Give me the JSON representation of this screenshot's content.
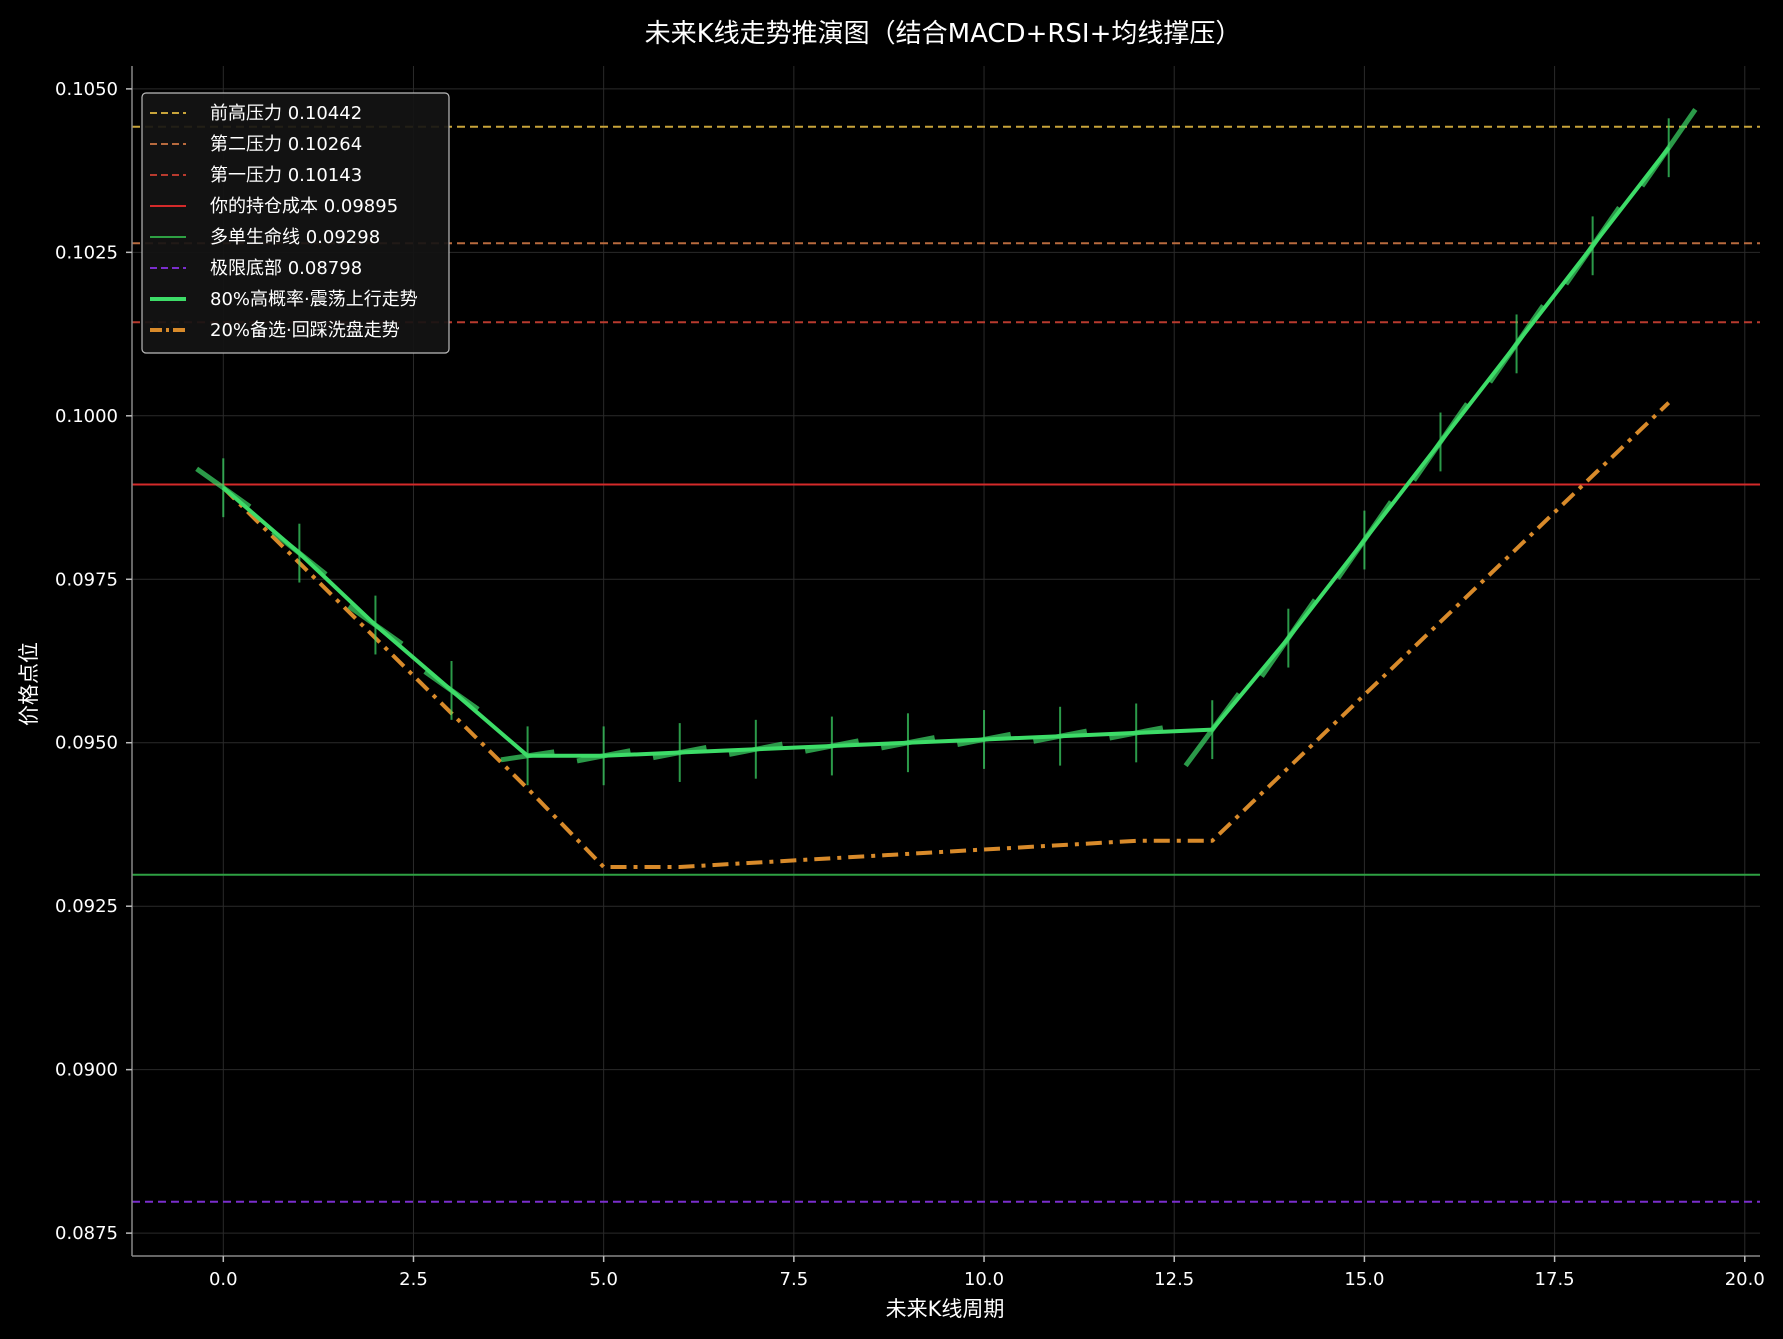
{
  "chart_data": {
    "type": "line",
    "title": "未来K线走势推演图（结合MACD+RSI+均线撑压）",
    "xlabel": "未来K线周期",
    "ylabel": "价格点位",
    "xlim": [
      -1.2,
      20.2
    ],
    "ylim": [
      0.08715,
      0.10535
    ],
    "xticks": [
      0.0,
      2.5,
      5.0,
      7.5,
      10.0,
      12.5,
      15.0,
      17.5,
      20.0
    ],
    "xtick_labels": [
      "0.0",
      "2.5",
      "5.0",
      "7.5",
      "10.0",
      "12.5",
      "15.0",
      "17.5",
      "20.0"
    ],
    "yticks": [
      0.0875,
      0.09,
      0.0925,
      0.095,
      0.0975,
      0.1,
      0.1025,
      0.105
    ],
    "ytick_labels": [
      "0.0875",
      "0.0900",
      "0.0925",
      "0.0950",
      "0.0975",
      "0.1000",
      "0.1025",
      "0.1050"
    ],
    "grid": true,
    "legend_position": "top-left",
    "hlines": [
      {
        "name": "前高压力 0.10442",
        "y": 0.10442,
        "color": "#c8a43a",
        "style": "dashed"
      },
      {
        "name": "第二压力 0.10264",
        "y": 0.10264,
        "color": "#b86a3e",
        "style": "dashed"
      },
      {
        "name": "第一压力 0.10143",
        "y": 0.10143,
        "color": "#b83a2e",
        "style": "dashed"
      },
      {
        "name": "你的持仓成本 0.09895",
        "y": 0.09895,
        "color": "#d42a2a",
        "style": "solid"
      },
      {
        "name": "多单生命线 0.09298",
        "y": 0.09298,
        "color": "#2ea043",
        "style": "solid"
      },
      {
        "name": "极限底部 0.08798",
        "y": 0.08798,
        "color": "#7a2ecc",
        "style": "dashed"
      }
    ],
    "series": [
      {
        "name": "80%高概率·震荡上行走势",
        "color": "#3ddc68",
        "style": "solid",
        "x": [
          0,
          1,
          2,
          3,
          4,
          5,
          6,
          7,
          8,
          9,
          10,
          11,
          12,
          13,
          14,
          15,
          16,
          17,
          18,
          19
        ],
        "y": [
          0.0989,
          0.0979,
          0.0968,
          0.0958,
          0.0948,
          0.0948,
          0.09485,
          0.0949,
          0.09495,
          0.095,
          0.09505,
          0.0951,
          0.09515,
          0.0952,
          0.0966,
          0.0981,
          0.0996,
          0.1011,
          0.1026,
          0.1041
        ],
        "error": 0.00045
      },
      {
        "name": "20%备选·回踩洗盘走势",
        "color": "#d88a2a",
        "style": "dashdot",
        "x": [
          0,
          4,
          5,
          6,
          12,
          13,
          19
        ],
        "y": [
          0.0989,
          0.0943,
          0.0931,
          0.0931,
          0.0935,
          0.0935,
          0.1002
        ]
      }
    ]
  }
}
